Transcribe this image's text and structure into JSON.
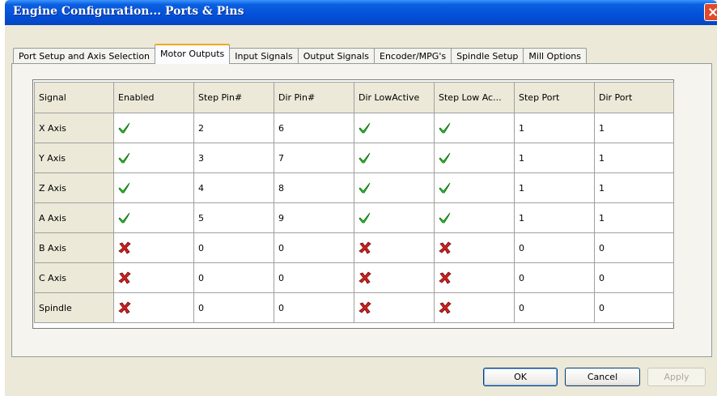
{
  "window": {
    "title": "Engine Configuration... Ports & Pins"
  },
  "tabs": [
    {
      "label": "Port Setup and Axis Selection",
      "active": false
    },
    {
      "label": "Motor Outputs",
      "active": true
    },
    {
      "label": "Input Signals",
      "active": false
    },
    {
      "label": "Output Signals",
      "active": false
    },
    {
      "label": "Encoder/MPG's",
      "active": false
    },
    {
      "label": "Spindle Setup",
      "active": false
    },
    {
      "label": "Mill Options",
      "active": false
    }
  ],
  "grid": {
    "columns": [
      "Signal",
      "Enabled",
      "Step Pin#",
      "Dir Pin#",
      "Dir LowActive",
      "Step Low Ac...",
      "Step Port",
      "Dir Port"
    ],
    "rows": [
      {
        "signal": "X Axis",
        "enabled": "check-icon",
        "step_pin": "2",
        "dir_pin": "6",
        "dir_low": "check-icon",
        "step_low": "check-icon",
        "step_port": "1",
        "dir_port": "1"
      },
      {
        "signal": "Y Axis",
        "enabled": "check-icon",
        "step_pin": "3",
        "dir_pin": "7",
        "dir_low": "check-icon",
        "step_low": "check-icon",
        "step_port": "1",
        "dir_port": "1"
      },
      {
        "signal": "Z Axis",
        "enabled": "check-icon",
        "step_pin": "4",
        "dir_pin": "8",
        "dir_low": "check-icon",
        "step_low": "check-icon",
        "step_port": "1",
        "dir_port": "1"
      },
      {
        "signal": "A Axis",
        "enabled": "check-icon",
        "step_pin": "5",
        "dir_pin": "9",
        "dir_low": "check-icon",
        "step_low": "check-icon",
        "step_port": "1",
        "dir_port": "1"
      },
      {
        "signal": "B Axis",
        "enabled": "cross-icon",
        "step_pin": "0",
        "dir_pin": "0",
        "dir_low": "cross-icon",
        "step_low": "cross-icon",
        "step_port": "0",
        "dir_port": "0"
      },
      {
        "signal": "C Axis",
        "enabled": "cross-icon",
        "step_pin": "0",
        "dir_pin": "0",
        "dir_low": "cross-icon",
        "step_low": "cross-icon",
        "step_port": "0",
        "dir_port": "0"
      },
      {
        "signal": "Spindle",
        "enabled": "cross-icon",
        "step_pin": "0",
        "dir_pin": "0",
        "dir_low": "cross-icon",
        "step_low": "cross-icon",
        "step_port": "0",
        "dir_port": "0"
      }
    ]
  },
  "buttons": {
    "ok": "OK",
    "cancel": "Cancel",
    "apply": "Apply"
  },
  "colors": {
    "check": "#2ecc2e",
    "cross": "#d42020",
    "title_bar": "#0450d8"
  }
}
